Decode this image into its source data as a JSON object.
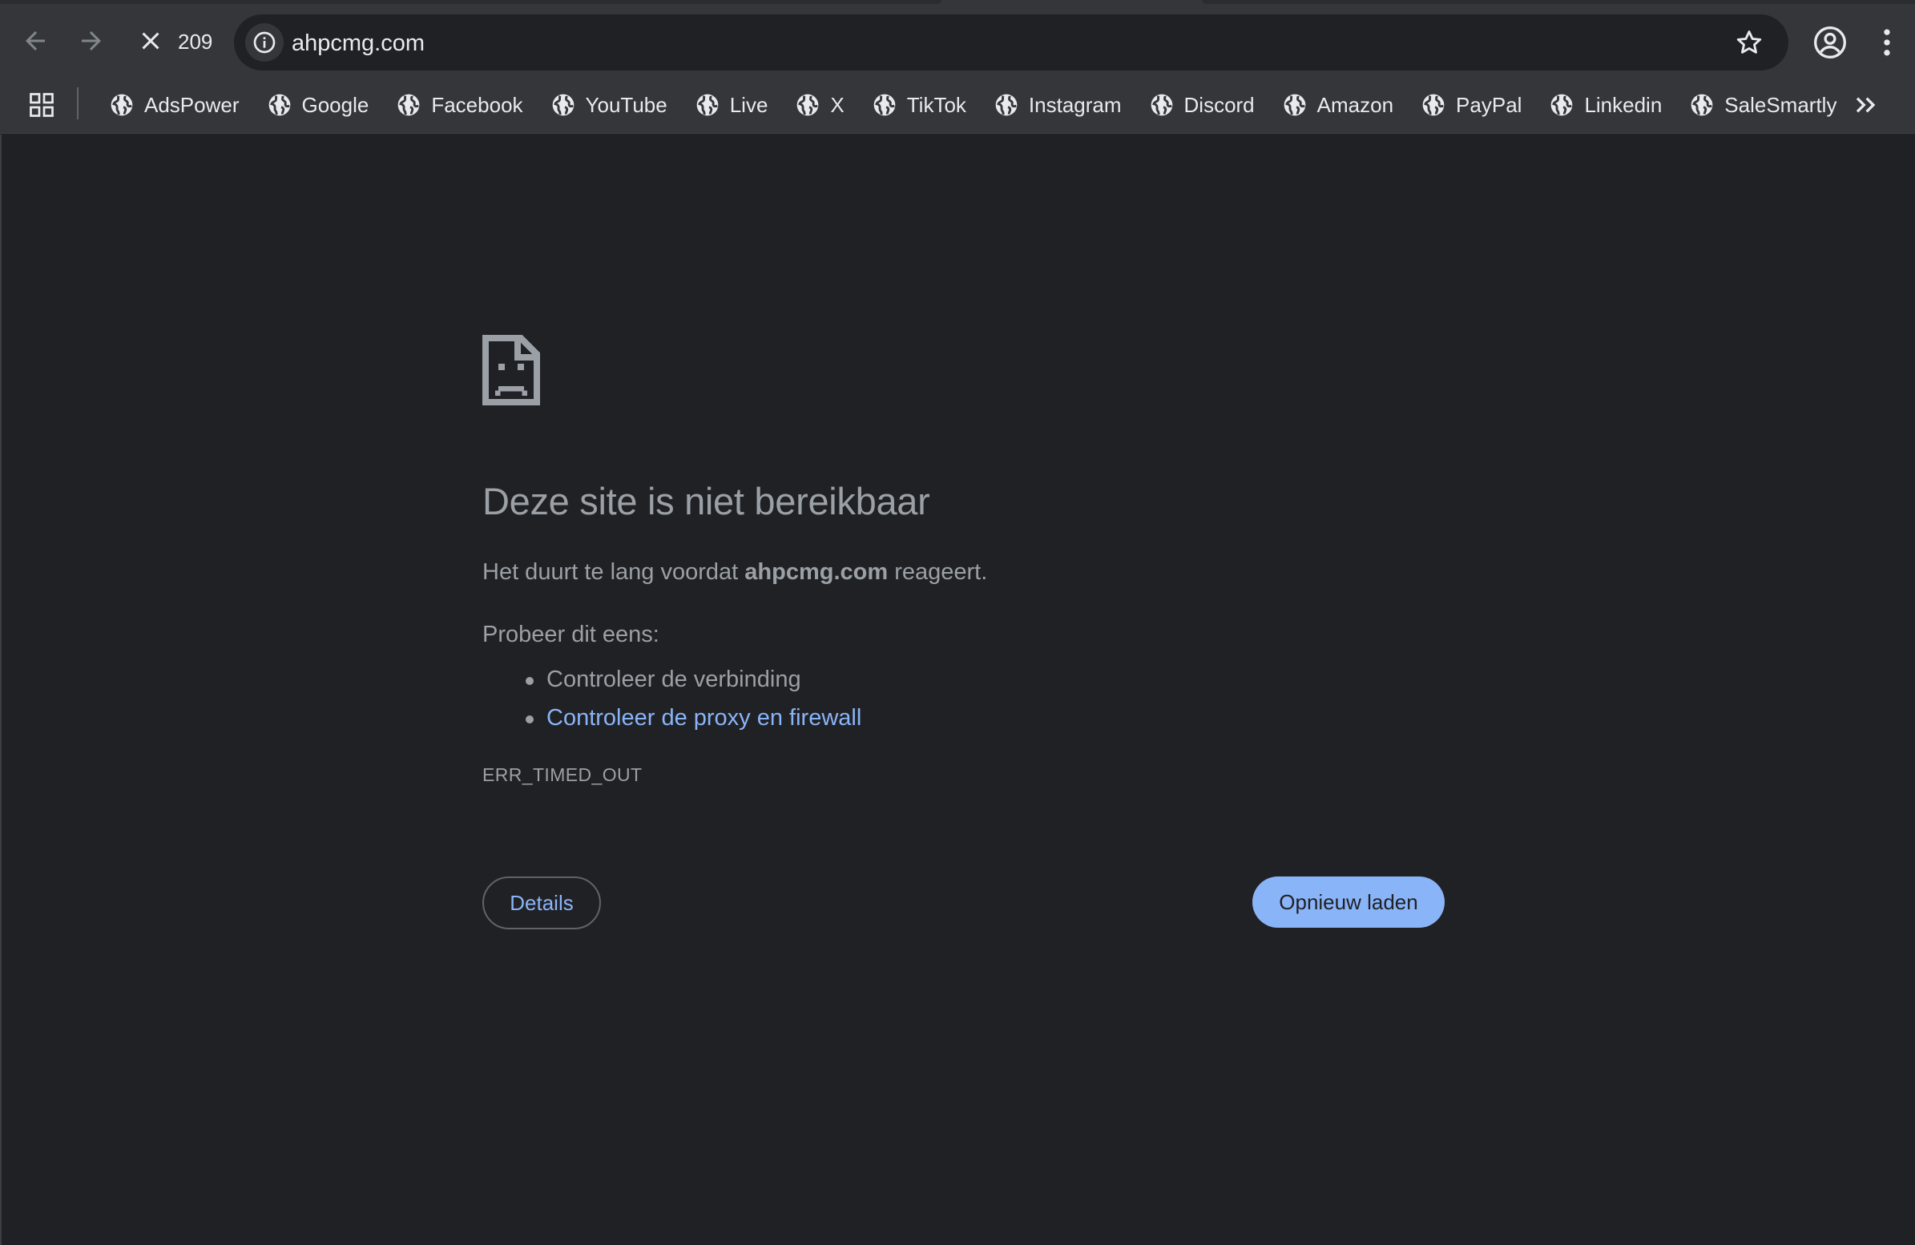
{
  "toolbar": {
    "tab_count": "209",
    "url": "ahpcmg.com"
  },
  "bookmarks": [
    {
      "label": "AdsPower"
    },
    {
      "label": "Google"
    },
    {
      "label": "Facebook"
    },
    {
      "label": "YouTube"
    },
    {
      "label": "Live"
    },
    {
      "label": "X"
    },
    {
      "label": "TikTok"
    },
    {
      "label": "Instagram"
    },
    {
      "label": "Discord"
    },
    {
      "label": "Amazon"
    },
    {
      "label": "PayPal"
    },
    {
      "label": "Linkedin"
    },
    {
      "label": "SaleSmartly"
    }
  ],
  "error": {
    "headline": "Deze site is niet bereikbaar",
    "summary_before": "Het duurt te lang voordat ",
    "summary_host": "ahpcmg.com",
    "summary_after": " reageert.",
    "suggest_title": "Probeer dit eens:",
    "suggestions": [
      {
        "text": "Controleer de verbinding"
      },
      {
        "text": "Controleer de proxy en firewall"
      }
    ],
    "code": "ERR_TIMED_OUT",
    "details_label": "Details",
    "reload_label": "Opnieuw laden"
  },
  "colors": {
    "background": "#202124",
    "toolbar": "#35363a",
    "link": "#8ab4f8",
    "text": "#9aa0a6"
  }
}
